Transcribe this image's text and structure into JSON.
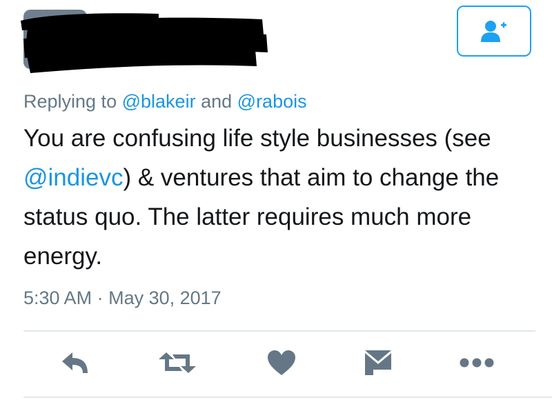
{
  "header": {
    "follow_button_icon": "add-user-icon",
    "accent_color": "#1da1f2"
  },
  "reply": {
    "prefix": "Replying to",
    "mention_1": "@blakeir",
    "joiner": "and",
    "mention_2": "@rabois"
  },
  "tweet": {
    "line_1": "You are confusing life style businesses (see",
    "line_2_mention": "@indievc",
    "line_2_rest": ") & ventures that aim to change the",
    "line_3": "status quo. The latter requires much more",
    "line_4": "energy."
  },
  "meta": {
    "time": "5:30 AM",
    "separator": "·",
    "date": "May 30, 2017"
  },
  "actions": [
    {
      "name": "reply",
      "icon": "reply-icon"
    },
    {
      "name": "retweet",
      "icon": "retweet-icon"
    },
    {
      "name": "like",
      "icon": "heart-icon"
    },
    {
      "name": "direct-message",
      "icon": "envelope-icon"
    },
    {
      "name": "more",
      "icon": "more-icon"
    }
  ],
  "colors": {
    "secondary_text": "#657786",
    "action_icon": "#657786",
    "link": "#1b95e0",
    "divider": "#e1e8ed"
  }
}
